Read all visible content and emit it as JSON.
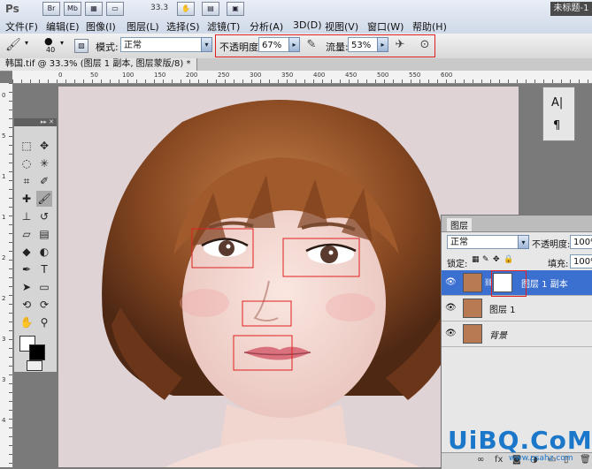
{
  "app": {
    "logo": "Ps",
    "window_badge": "未标题-1",
    "zoom": "33.3"
  },
  "menu": [
    "文件(F)",
    "编辑(E)",
    "图像(I)",
    "图层(L)",
    "选择(S)",
    "滤镜(T)",
    "分析(A)",
    "3D(D)",
    "视图(V)",
    "窗口(W)",
    "帮助(H)"
  ],
  "toolbar_icons": [
    "Br",
    "Mb"
  ],
  "options": {
    "brush_size": "40",
    "mode_label": "模式:",
    "mode_value": "正常",
    "opacity_label": "不透明度:",
    "opacity_value": "67%",
    "flow_label": "流量:",
    "flow_value": "53%"
  },
  "document_tab": "韩国.tif @ 33.3% (图层 1 副本, 图层蒙版/8) *",
  "ruler_numbers": [
    "0",
    "50",
    "100",
    "150",
    "200",
    "250",
    "300",
    "350",
    "400",
    "450",
    "500",
    "550",
    "600"
  ],
  "vruler_numbers": [
    "0",
    "5",
    "1",
    "1",
    "2",
    "2",
    "3",
    "3",
    "4"
  ],
  "mini_panel": {
    "char_icon": "A|",
    "para_icon": "¶"
  },
  "layers_panel": {
    "tab_label": "图层",
    "blend_mode": "正常",
    "opacity_label": "不透明度:",
    "opacity_value": "100%",
    "lock_label": "锁定:",
    "fill_label": "填充:",
    "fill_value": "100%",
    "layers": [
      {
        "name": "图层 1 副本",
        "selected": true
      },
      {
        "name": "图层 1",
        "selected": false
      },
      {
        "name": "背景",
        "selected": false
      }
    ]
  },
  "watermark": {
    "main": "UiBQ.CoM",
    "sub": "www.psahz.com"
  },
  "colors": {
    "accent": "#3b6fd0",
    "annotation": "#e02020",
    "watermark": "#1a77c9"
  }
}
